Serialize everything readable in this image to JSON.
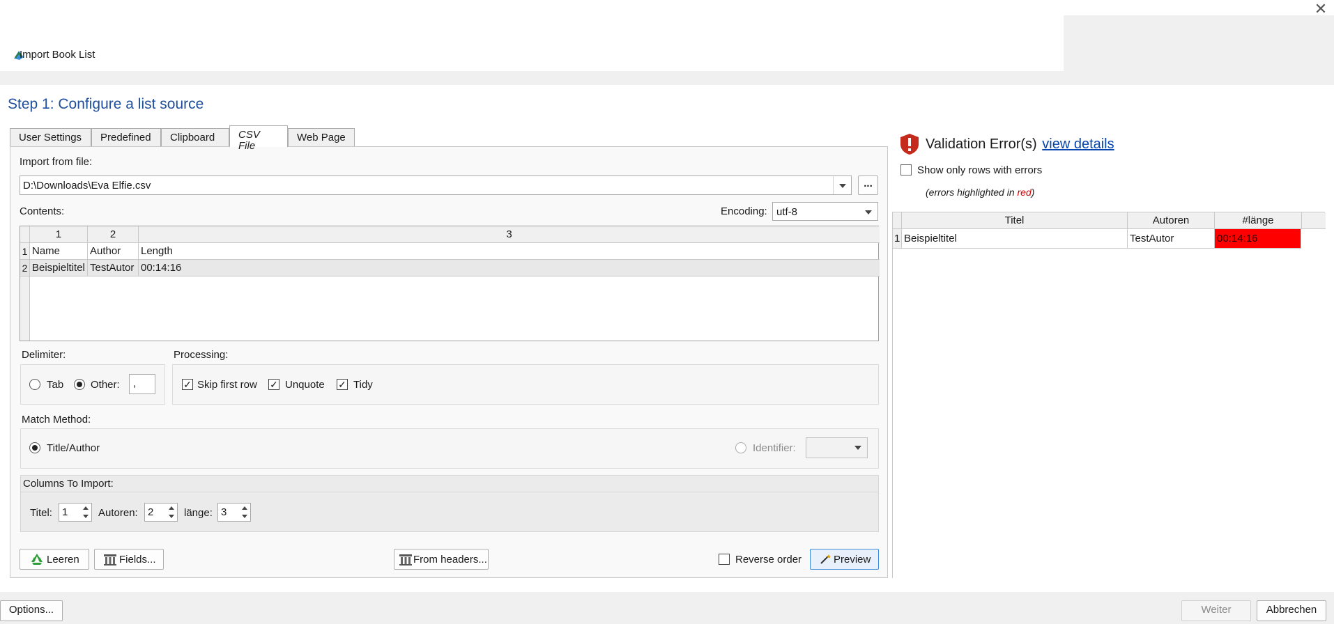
{
  "window": {
    "title": "Import Book List",
    "close_icon": "close-icon",
    "app_icon": "book-app-icon"
  },
  "step": {
    "title": "Step 1: Configure a list source"
  },
  "tabs": [
    {
      "label": "User Settings"
    },
    {
      "label": "Predefined"
    },
    {
      "label": "Clipboard"
    },
    {
      "label": "CSV File",
      "active": true
    },
    {
      "label": "Web Page"
    }
  ],
  "import_file": {
    "label": "Import from file:",
    "value": "D:\\Downloads\\Eva Elfie.csv",
    "browse_label": "..."
  },
  "contents": {
    "label": "Contents:",
    "encoding_label": "Encoding:",
    "encoding_value": "utf-8",
    "column_headers": [
      "1",
      "2",
      "3"
    ],
    "rows": [
      {
        "num": "1",
        "cells": [
          "Name",
          "Author",
          "Length"
        ]
      },
      {
        "num": "2",
        "cells": [
          "Beispieltitel",
          "TestAutor",
          "00:14:16"
        ]
      }
    ]
  },
  "delimiter": {
    "label": "Delimiter:",
    "tab_label": "Tab",
    "other_label": "Other:",
    "other_value": ",",
    "selected": "other"
  },
  "processing": {
    "label": "Processing:",
    "skip_first_row": {
      "label": "Skip first row",
      "checked": true
    },
    "unquote": {
      "label": "Unquote",
      "checked": true
    },
    "tidy": {
      "label": "Tidy",
      "checked": true
    }
  },
  "match_method": {
    "label": "Match Method:",
    "title_author_label": "Title/Author",
    "identifier_label": "Identifier:",
    "selected": "title_author"
  },
  "columns_to_import": {
    "label": "Columns To Import:",
    "titel_label": "Titel:",
    "titel_value": "1",
    "autoren_label": "Autoren:",
    "autoren_value": "2",
    "laenge_label": "länge:",
    "laenge_value": "3"
  },
  "actions": {
    "clear_label": "Leeren",
    "fields_label": "Fields...",
    "from_headers_label": "From headers...",
    "reverse_order_label": "Reverse order",
    "preview_label": "Preview"
  },
  "validation": {
    "title": "Validation Error(s)",
    "link": "view details",
    "show_only_errors_label": "Show only rows with errors",
    "hint_prefix": "(errors highlighted in ",
    "hint_red": "red",
    "hint_suffix": ")",
    "error_color": "#ff0000",
    "headers": [
      "Titel",
      "Autoren",
      "#länge"
    ],
    "rows": [
      {
        "num": "1",
        "cells": [
          "Beispieltitel",
          "TestAutor",
          "00:14:16"
        ],
        "error_col": 2
      }
    ]
  },
  "footer": {
    "options_label": "Options...",
    "next_label": "Weiter",
    "cancel_label": "Abbrechen"
  }
}
